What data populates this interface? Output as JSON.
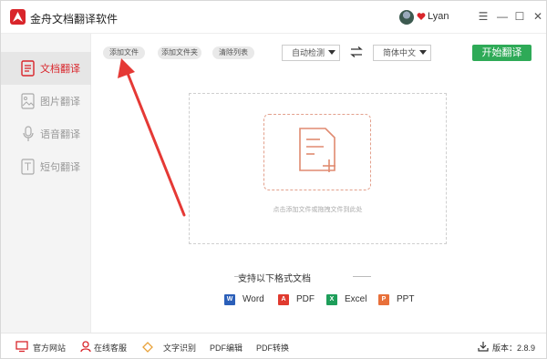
{
  "app": {
    "title": "金舟文档翻译软件"
  },
  "user": {
    "name": "Lyan"
  },
  "window_controls": {
    "menu": "☰",
    "minimize": "—",
    "maximize": "☐",
    "close": "✕"
  },
  "sidebar": {
    "items": [
      {
        "label": "文档翻译",
        "icon": "document-icon",
        "active": true
      },
      {
        "label": "图片翻译",
        "icon": "image-icon",
        "active": false
      },
      {
        "label": "语音翻译",
        "icon": "microphone-icon",
        "active": false
      },
      {
        "label": "短句翻译",
        "icon": "text-icon",
        "active": false
      }
    ]
  },
  "toolbar": {
    "add_file": "添加文件",
    "add_folder": "添加文件夹",
    "clear_list": "清除列表",
    "source_lang": "自动检测",
    "target_lang": "简体中文",
    "start": "开始翻译"
  },
  "dropzone": {
    "hint": "点击添加文件或拖拽文件到此处"
  },
  "formats": {
    "title": "支持以下格式文档",
    "items": [
      {
        "label": "Word",
        "badge": "W",
        "color": "#2b5fb9"
      },
      {
        "label": "PDF",
        "badge": "A",
        "color": "#e03a2f"
      },
      {
        "label": "Excel",
        "badge": "X",
        "color": "#1e9e5a"
      },
      {
        "label": "PPT",
        "badge": "P",
        "color": "#e8703a"
      }
    ]
  },
  "statusbar": {
    "website": "官方网站",
    "support": "在线客服",
    "ocr": "文字识别",
    "pdf_edit": "PDF编辑",
    "pdf_convert": "PDF转换",
    "version": "版本：2.8.9"
  },
  "colors": {
    "accent": "#d9252b",
    "primary_button": "#2eaa57",
    "annotation": "#e53935"
  }
}
